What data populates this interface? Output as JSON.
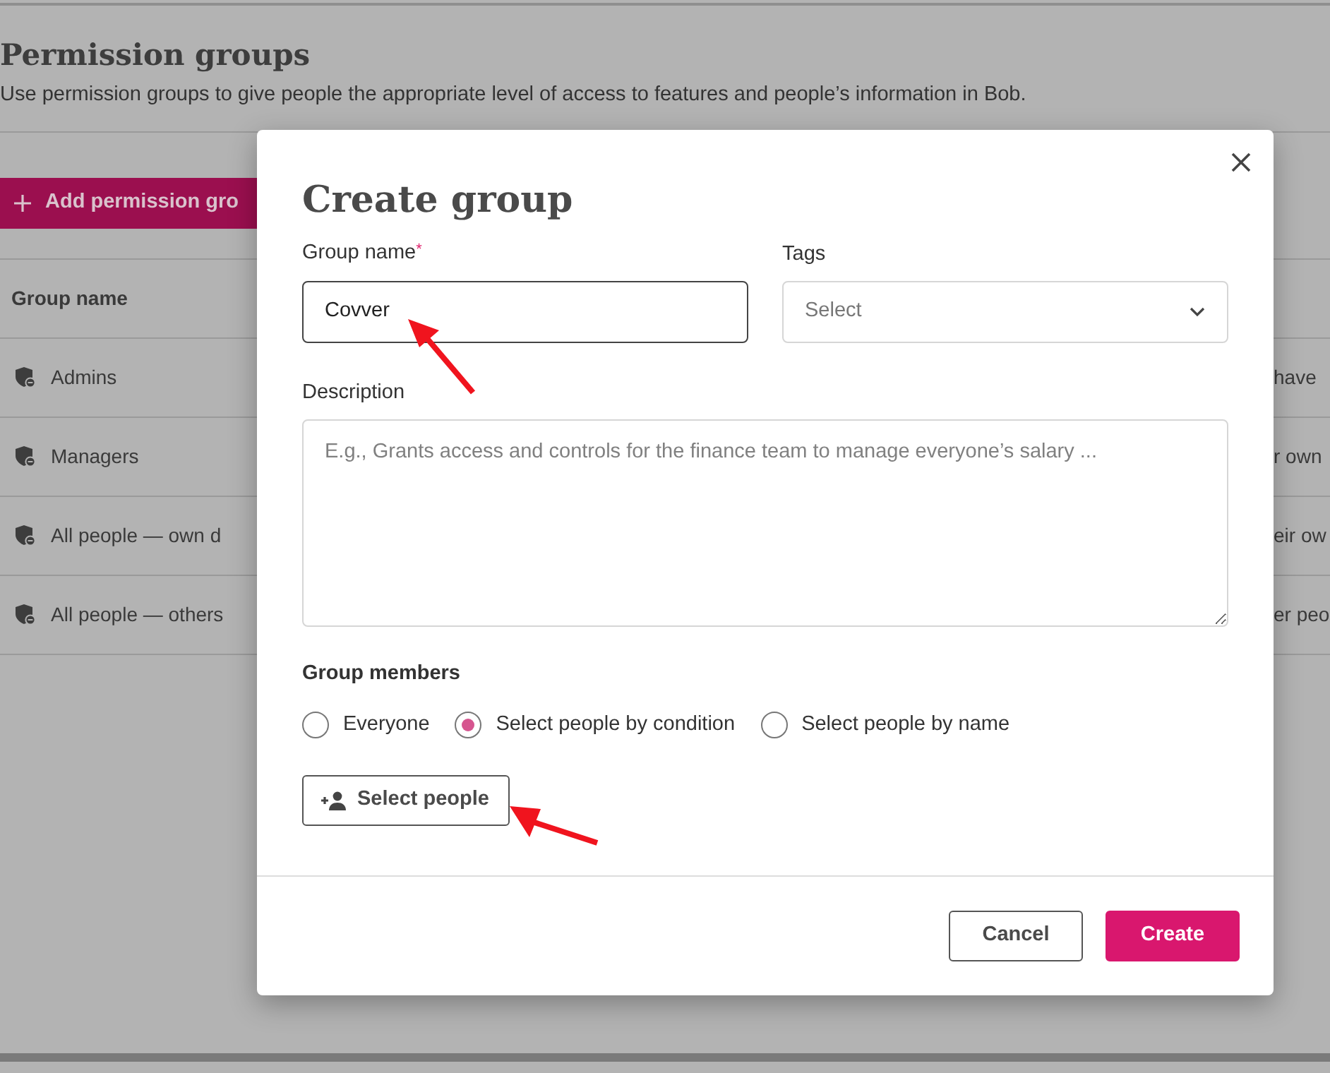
{
  "page": {
    "title": "Permission groups",
    "subtitle": "Use permission groups to give people the appropriate level of access to features and people’s information in Bob.",
    "add_button": "Add permission gro",
    "table": {
      "columns": [
        "Group name"
      ],
      "rows": [
        {
          "column_1": "Admins",
          "column_2": "have"
        },
        {
          "column_1": "Managers",
          "column_2": "r own"
        },
        {
          "column_1": "All people — own d",
          "column_2": "eir ow"
        },
        {
          "column_1": "All people — others",
          "column_2": "er peo"
        }
      ]
    }
  },
  "dialog": {
    "title": "Create group",
    "group_name": {
      "label": "Group name",
      "required_mark": "*",
      "value": "Covver"
    },
    "tags": {
      "label": "Tags",
      "placeholder": "Select"
    },
    "description": {
      "label": "Description",
      "placeholder": "E.g., Grants access and controls for the finance team to manage everyone’s salary ..."
    },
    "members": {
      "label": "Group members",
      "options": [
        {
          "label": "Everyone",
          "selected": false
        },
        {
          "label": "Select people by condition",
          "selected": true
        },
        {
          "label": "Select people by name",
          "selected": false
        }
      ]
    },
    "select_people_button": "Select people",
    "buttons": [
      {
        "kind": "secondary",
        "label": "Cancel"
      },
      {
        "kind": "primary",
        "label": "Create"
      }
    ]
  }
}
